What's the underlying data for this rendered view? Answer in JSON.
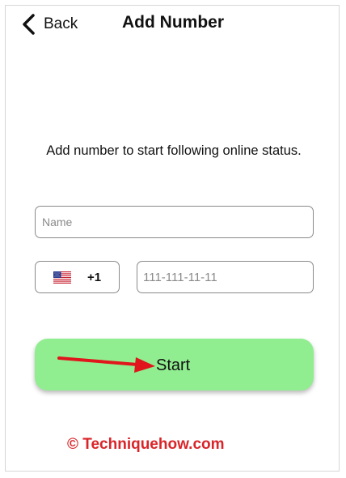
{
  "header": {
    "back_label": "Back",
    "title": "Add Number"
  },
  "main": {
    "instruction": "Add number to start following online status.",
    "name_placeholder": "Name",
    "country": {
      "flag": "us-flag-icon",
      "code": "+1"
    },
    "phone_placeholder": "111-111-11-11",
    "start_label": "Start"
  },
  "watermark": "© Techniquehow.com",
  "colors": {
    "start_button": "#90ee90",
    "arrow": "#e0161c",
    "watermark": "#d9252a",
    "input_border": "#8a8a8a"
  }
}
